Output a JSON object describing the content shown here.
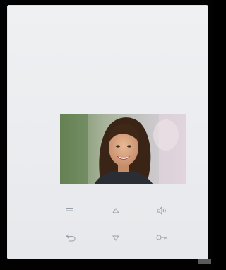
{
  "device": {
    "panel_color": "#eceef0",
    "icon_color": "#9aa0a8"
  },
  "screen": {
    "content": "video-feed-visitor"
  },
  "keys": [
    {
      "name": "menu-icon"
    },
    {
      "name": "up-arrow-icon"
    },
    {
      "name": "volume-icon"
    },
    {
      "name": "back-icon"
    },
    {
      "name": "down-arrow-icon"
    },
    {
      "name": "unlock-key-icon"
    }
  ],
  "brand_mark": ""
}
